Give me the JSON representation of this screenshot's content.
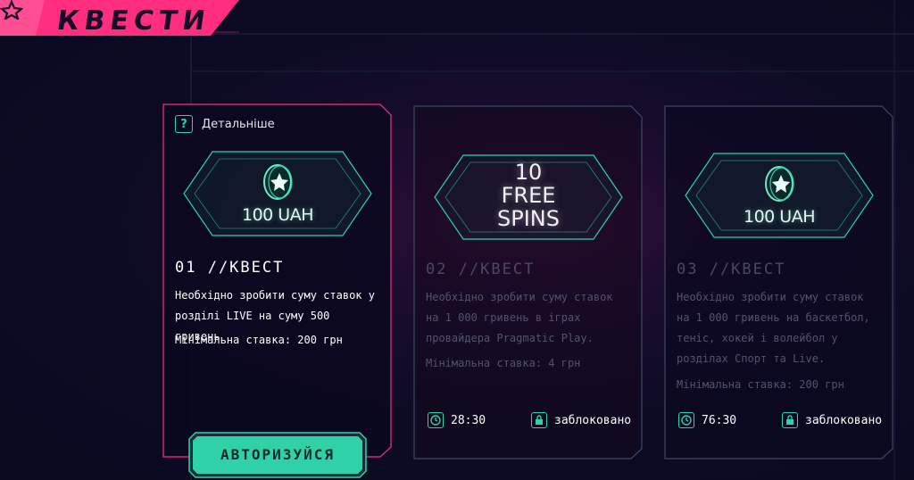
{
  "header": {
    "title": "КВЕСТИ",
    "accent": "#ff2e7e"
  },
  "quests": [
    {
      "details_label": "Детальніше",
      "prize": "100 UAH",
      "title": "01 //КВЕСТ",
      "description": "Необхідно зробити суму ставок у розділі LIVE на суму 500 гривень",
      "min_bet": "Мінімальна ставка: 200 грн",
      "button_label": "АВТОРИЗУЙСЯ"
    },
    {
      "prize_lines": [
        "10",
        "FREE",
        "SPINS"
      ],
      "title": "02 //КВЕСТ",
      "description": "Необхідно зробити суму ставок на 1 000 гривень в іграх провайдера Pragmatic Play.",
      "min_bet": "Мінімальна ставка: 4 грн",
      "timer": "28:30",
      "status": "заблоковано"
    },
    {
      "prize": "100 UAH",
      "title": "03 //КВЕСТ",
      "description": "Необхідно зробити суму ставок на 1 000 гривень на баскетбол, теніс, хокей і волейбол у розділах Спорт та Live.",
      "min_bet": "Мінімальна ставка: 200 грн",
      "timer": "76:30",
      "status": "заблоковано"
    }
  ],
  "colors": {
    "teal": "#2fd1a8",
    "pink": "#ff2e7e",
    "card_border": "#3c4866"
  }
}
